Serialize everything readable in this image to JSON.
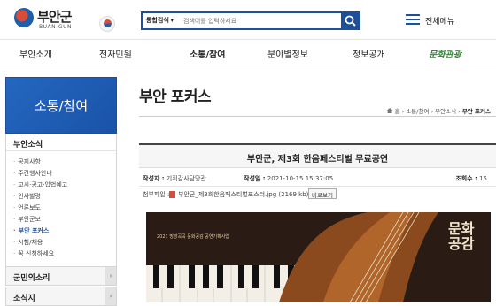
{
  "header": {
    "logo_name": "부안군",
    "logo_sub": "BUAN-GUN",
    "search_scope": "통합검색",
    "search_placeholder": "검색어를 입력하세요",
    "allmenu_label": "전체메뉴"
  },
  "gnb": [
    "부안소개",
    "전자민원",
    "소통/참여",
    "분야별정보",
    "정보공개",
    "문화관광"
  ],
  "lnb": {
    "title": "소통/참여",
    "group_title": "부안소식",
    "items": [
      "공지사항",
      "주간행사안내",
      "고시·공고·입법예고",
      "인사발령",
      "언론보도",
      "부안군보",
      "부안 포커스",
      "시험/채용",
      "꼭 신청하세요"
    ],
    "bars": [
      "군민의소리",
      "소식지"
    ]
  },
  "page": {
    "title": "부안 포커스",
    "breadcrumb": [
      "홈",
      "소통/참여",
      "부안소식",
      "부안 포커스"
    ]
  },
  "post": {
    "title": "부안군, 제3회 한음페스티벌 무료공연",
    "author_label": "작성자 :",
    "author": "기획감사담당관",
    "date_label": "작성일 :",
    "date": "2021-10-15 15:37:05",
    "views_label": "조회수 :",
    "views": "15",
    "attach_label": "첨부파일 :",
    "attach_file": "부안군_제3회한음페스티벌포스터.jpg (2169 kb)",
    "preview_label": "바로보기",
    "poster_caption": "2021 방방곡곡 문화공감 공연기획사업",
    "poster_calligraphy": "문화공감"
  },
  "colors": {
    "brand_blue": "#1d4f9b",
    "lnb_blue": "#2467c0",
    "culture_green": "#2c8a2c"
  }
}
